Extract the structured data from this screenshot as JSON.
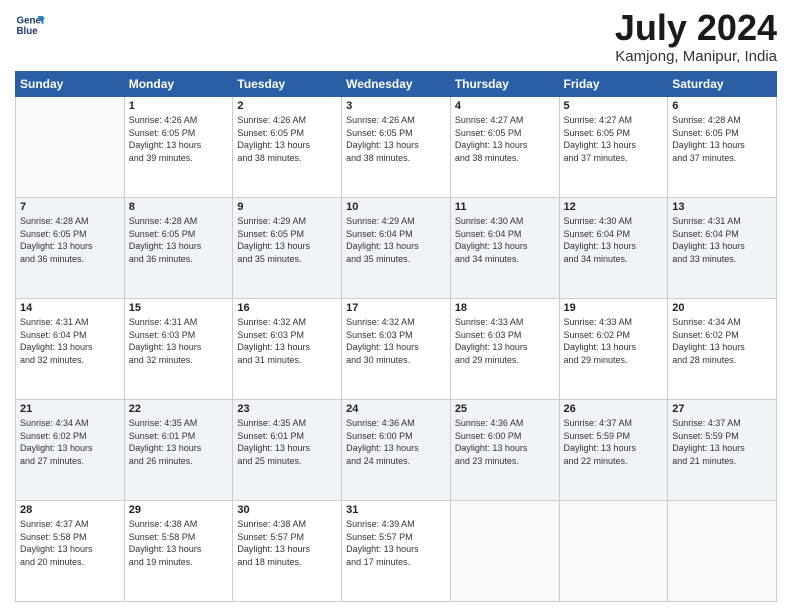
{
  "header": {
    "logo_line1": "General",
    "logo_line2": "Blue",
    "month": "July 2024",
    "location": "Kamjong, Manipur, India"
  },
  "days_of_week": [
    "Sunday",
    "Monday",
    "Tuesday",
    "Wednesday",
    "Thursday",
    "Friday",
    "Saturday"
  ],
  "weeks": [
    [
      {
        "day": "",
        "content": ""
      },
      {
        "day": "1",
        "content": "Sunrise: 4:26 AM\nSunset: 6:05 PM\nDaylight: 13 hours\nand 39 minutes."
      },
      {
        "day": "2",
        "content": "Sunrise: 4:26 AM\nSunset: 6:05 PM\nDaylight: 13 hours\nand 38 minutes."
      },
      {
        "day": "3",
        "content": "Sunrise: 4:26 AM\nSunset: 6:05 PM\nDaylight: 13 hours\nand 38 minutes."
      },
      {
        "day": "4",
        "content": "Sunrise: 4:27 AM\nSunset: 6:05 PM\nDaylight: 13 hours\nand 38 minutes."
      },
      {
        "day": "5",
        "content": "Sunrise: 4:27 AM\nSunset: 6:05 PM\nDaylight: 13 hours\nand 37 minutes."
      },
      {
        "day": "6",
        "content": "Sunrise: 4:28 AM\nSunset: 6:05 PM\nDaylight: 13 hours\nand 37 minutes."
      }
    ],
    [
      {
        "day": "7",
        "content": "Sunrise: 4:28 AM\nSunset: 6:05 PM\nDaylight: 13 hours\nand 36 minutes."
      },
      {
        "day": "8",
        "content": "Sunrise: 4:28 AM\nSunset: 6:05 PM\nDaylight: 13 hours\nand 36 minutes."
      },
      {
        "day": "9",
        "content": "Sunrise: 4:29 AM\nSunset: 6:05 PM\nDaylight: 13 hours\nand 35 minutes."
      },
      {
        "day": "10",
        "content": "Sunrise: 4:29 AM\nSunset: 6:04 PM\nDaylight: 13 hours\nand 35 minutes."
      },
      {
        "day": "11",
        "content": "Sunrise: 4:30 AM\nSunset: 6:04 PM\nDaylight: 13 hours\nand 34 minutes."
      },
      {
        "day": "12",
        "content": "Sunrise: 4:30 AM\nSunset: 6:04 PM\nDaylight: 13 hours\nand 34 minutes."
      },
      {
        "day": "13",
        "content": "Sunrise: 4:31 AM\nSunset: 6:04 PM\nDaylight: 13 hours\nand 33 minutes."
      }
    ],
    [
      {
        "day": "14",
        "content": "Sunrise: 4:31 AM\nSunset: 6:04 PM\nDaylight: 13 hours\nand 32 minutes."
      },
      {
        "day": "15",
        "content": "Sunrise: 4:31 AM\nSunset: 6:03 PM\nDaylight: 13 hours\nand 32 minutes."
      },
      {
        "day": "16",
        "content": "Sunrise: 4:32 AM\nSunset: 6:03 PM\nDaylight: 13 hours\nand 31 minutes."
      },
      {
        "day": "17",
        "content": "Sunrise: 4:32 AM\nSunset: 6:03 PM\nDaylight: 13 hours\nand 30 minutes."
      },
      {
        "day": "18",
        "content": "Sunrise: 4:33 AM\nSunset: 6:03 PM\nDaylight: 13 hours\nand 29 minutes."
      },
      {
        "day": "19",
        "content": "Sunrise: 4:33 AM\nSunset: 6:02 PM\nDaylight: 13 hours\nand 29 minutes."
      },
      {
        "day": "20",
        "content": "Sunrise: 4:34 AM\nSunset: 6:02 PM\nDaylight: 13 hours\nand 28 minutes."
      }
    ],
    [
      {
        "day": "21",
        "content": "Sunrise: 4:34 AM\nSunset: 6:02 PM\nDaylight: 13 hours\nand 27 minutes."
      },
      {
        "day": "22",
        "content": "Sunrise: 4:35 AM\nSunset: 6:01 PM\nDaylight: 13 hours\nand 26 minutes."
      },
      {
        "day": "23",
        "content": "Sunrise: 4:35 AM\nSunset: 6:01 PM\nDaylight: 13 hours\nand 25 minutes."
      },
      {
        "day": "24",
        "content": "Sunrise: 4:36 AM\nSunset: 6:00 PM\nDaylight: 13 hours\nand 24 minutes."
      },
      {
        "day": "25",
        "content": "Sunrise: 4:36 AM\nSunset: 6:00 PM\nDaylight: 13 hours\nand 23 minutes."
      },
      {
        "day": "26",
        "content": "Sunrise: 4:37 AM\nSunset: 5:59 PM\nDaylight: 13 hours\nand 22 minutes."
      },
      {
        "day": "27",
        "content": "Sunrise: 4:37 AM\nSunset: 5:59 PM\nDaylight: 13 hours\nand 21 minutes."
      }
    ],
    [
      {
        "day": "28",
        "content": "Sunrise: 4:37 AM\nSunset: 5:58 PM\nDaylight: 13 hours\nand 20 minutes."
      },
      {
        "day": "29",
        "content": "Sunrise: 4:38 AM\nSunset: 5:58 PM\nDaylight: 13 hours\nand 19 minutes."
      },
      {
        "day": "30",
        "content": "Sunrise: 4:38 AM\nSunset: 5:57 PM\nDaylight: 13 hours\nand 18 minutes."
      },
      {
        "day": "31",
        "content": "Sunrise: 4:39 AM\nSunset: 5:57 PM\nDaylight: 13 hours\nand 17 minutes."
      },
      {
        "day": "",
        "content": ""
      },
      {
        "day": "",
        "content": ""
      },
      {
        "day": "",
        "content": ""
      }
    ]
  ]
}
